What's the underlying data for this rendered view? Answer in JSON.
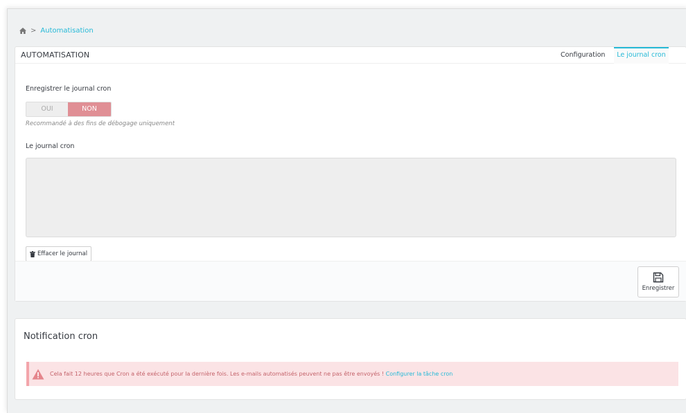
{
  "breadcrumb": {
    "current": "Automatisation",
    "separator": ">"
  },
  "panel": {
    "title": "AUTOMATISATION",
    "tabs": [
      {
        "label": "Configuration"
      },
      {
        "label": "Le journal cron"
      }
    ],
    "active_tab": "Le journal cron",
    "save_log_label": "Enregistrer le journal cron",
    "toggle": {
      "yes": "OUI",
      "no": "NON",
      "selected": "NON"
    },
    "hint": "Recommandé à des fins de débogage uniquement",
    "log_label": "Le journal cron",
    "log_content": "",
    "clear_button": "Effacer le journal",
    "save_button": "Enregistrer"
  },
  "notification": {
    "title": "Notification cron",
    "alert_text": "Cela fait 12 heures que Cron a été exécuté pour la dernière fois. Les e-mails automatisés peuvent ne pas être envoyés !",
    "alert_link": "Configurer la tâche cron"
  },
  "colors": {
    "accent": "#25b9d7",
    "toggle_off": "#e08f95",
    "alert_bg": "#fbe3e5",
    "alert_text": "#c4636b"
  }
}
